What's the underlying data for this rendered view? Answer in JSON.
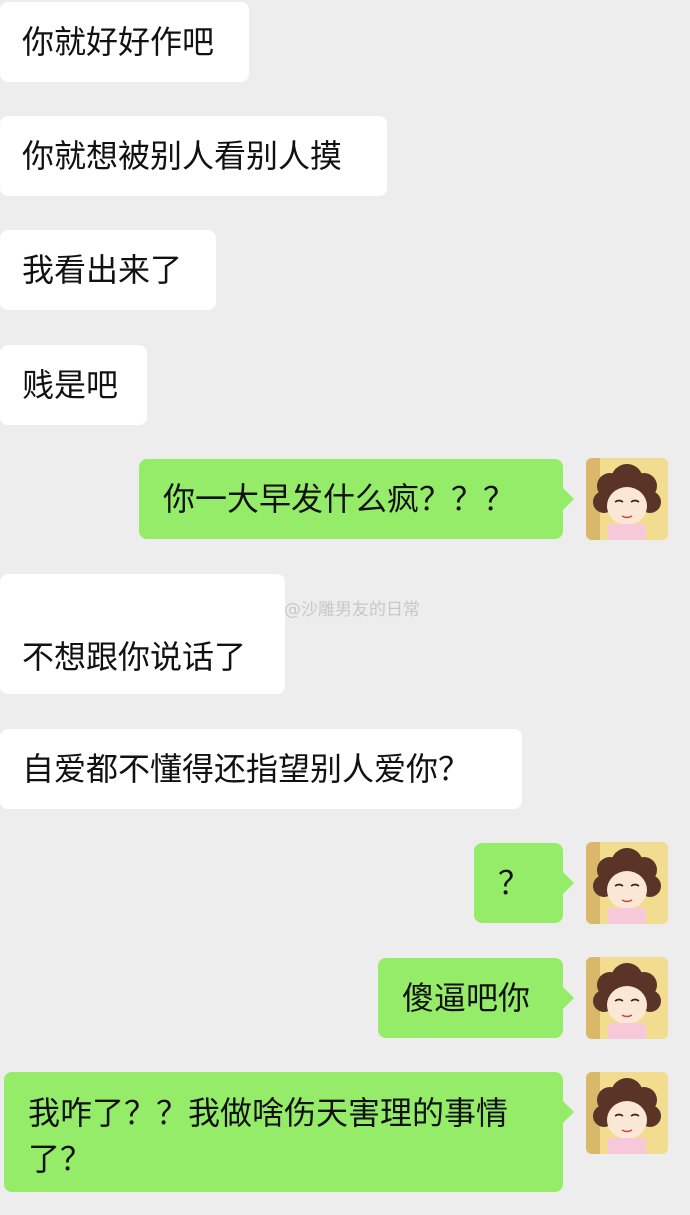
{
  "messages": [
    {
      "side": "left",
      "text": "你就好好作吧"
    },
    {
      "side": "left",
      "text": "你就想被别人看别人摸"
    },
    {
      "side": "left",
      "text": "我看出来了"
    },
    {
      "side": "left",
      "text": "贱是吧"
    },
    {
      "side": "right",
      "text": "你一大早发什么疯？？？"
    },
    {
      "side": "left",
      "text": "不想跟你说话了"
    },
    {
      "side": "left",
      "text": "自爱都不懂得还指望别人爱你？"
    },
    {
      "side": "right",
      "text": "？"
    },
    {
      "side": "right",
      "text": "傻逼吧你"
    },
    {
      "side": "right",
      "text": "我咋了？？我做啥伤天害理的事情了？"
    }
  ],
  "watermark": {
    "text": "@沙雕男友的日常",
    "icon": "weibo-icon"
  },
  "colors": {
    "background": "#ededed",
    "left_bubble": "#ffffff",
    "right_bubble": "#95ec69"
  },
  "avatar": {
    "icon": "cartoon-girl-avatar-icon"
  }
}
